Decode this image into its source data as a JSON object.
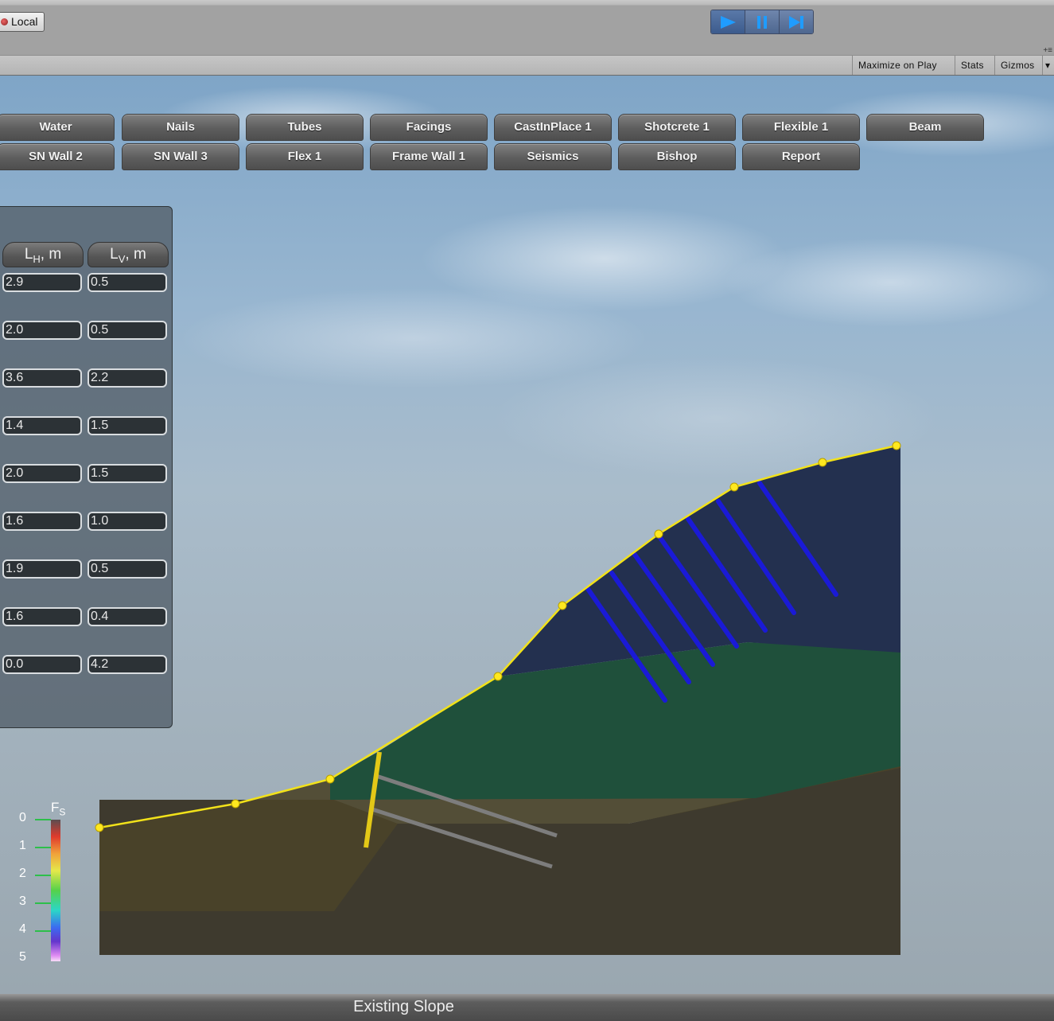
{
  "toolbar": {
    "local_label": "Local",
    "play_controls": [
      "play-icon",
      "pause-icon",
      "step-icon"
    ]
  },
  "viewbar": {
    "maximize_on_play": "Maximize on Play",
    "stats": "Stats",
    "gizmos": "Gizmos",
    "menu_glyph": "+≡"
  },
  "tabs_row1": [
    "Water",
    "Nails",
    "Tubes",
    "Facings",
    "CastInPlace 1",
    "Shotcrete 1",
    "Flexible 1",
    "Beam"
  ],
  "tabs_row2": [
    "SN Wall 2",
    "SN Wall 3",
    "Flex 1",
    "Frame Wall 1",
    "Seismics",
    "Bishop",
    "Report"
  ],
  "panel": {
    "col_lh": {
      "main": "L",
      "sub": "H",
      "unit": ", m"
    },
    "col_lv": {
      "main": "L",
      "sub": "V",
      "unit": ", m"
    },
    "rows": [
      {
        "lh": "2.9",
        "lv": "0.5"
      },
      {
        "lh": "2.0",
        "lv": "0.5"
      },
      {
        "lh": "3.6",
        "lv": "2.2"
      },
      {
        "lh": "1.4",
        "lv": "1.5"
      },
      {
        "lh": "2.0",
        "lv": "1.5"
      },
      {
        "lh": "1.6",
        "lv": "1.0"
      },
      {
        "lh": "1.9",
        "lv": "0.5"
      },
      {
        "lh": "1.6",
        "lv": "0.4"
      },
      {
        "lh": "0.0",
        "lv": "4.2"
      }
    ]
  },
  "legend": {
    "title_main": "F",
    "title_sub": "S",
    "labels": [
      "0",
      "1",
      "2",
      "3",
      "4",
      "5"
    ]
  },
  "status": "Existing Slope",
  "colors": {
    "slope_outline": "#f2e21a",
    "nails": "#1a1ad6",
    "upper_layer": "#23304f",
    "middle_layer": "#1e5038",
    "lower_layer": "#4a4429",
    "wall": "#e3c817",
    "anchors": "#7d7d7d"
  }
}
